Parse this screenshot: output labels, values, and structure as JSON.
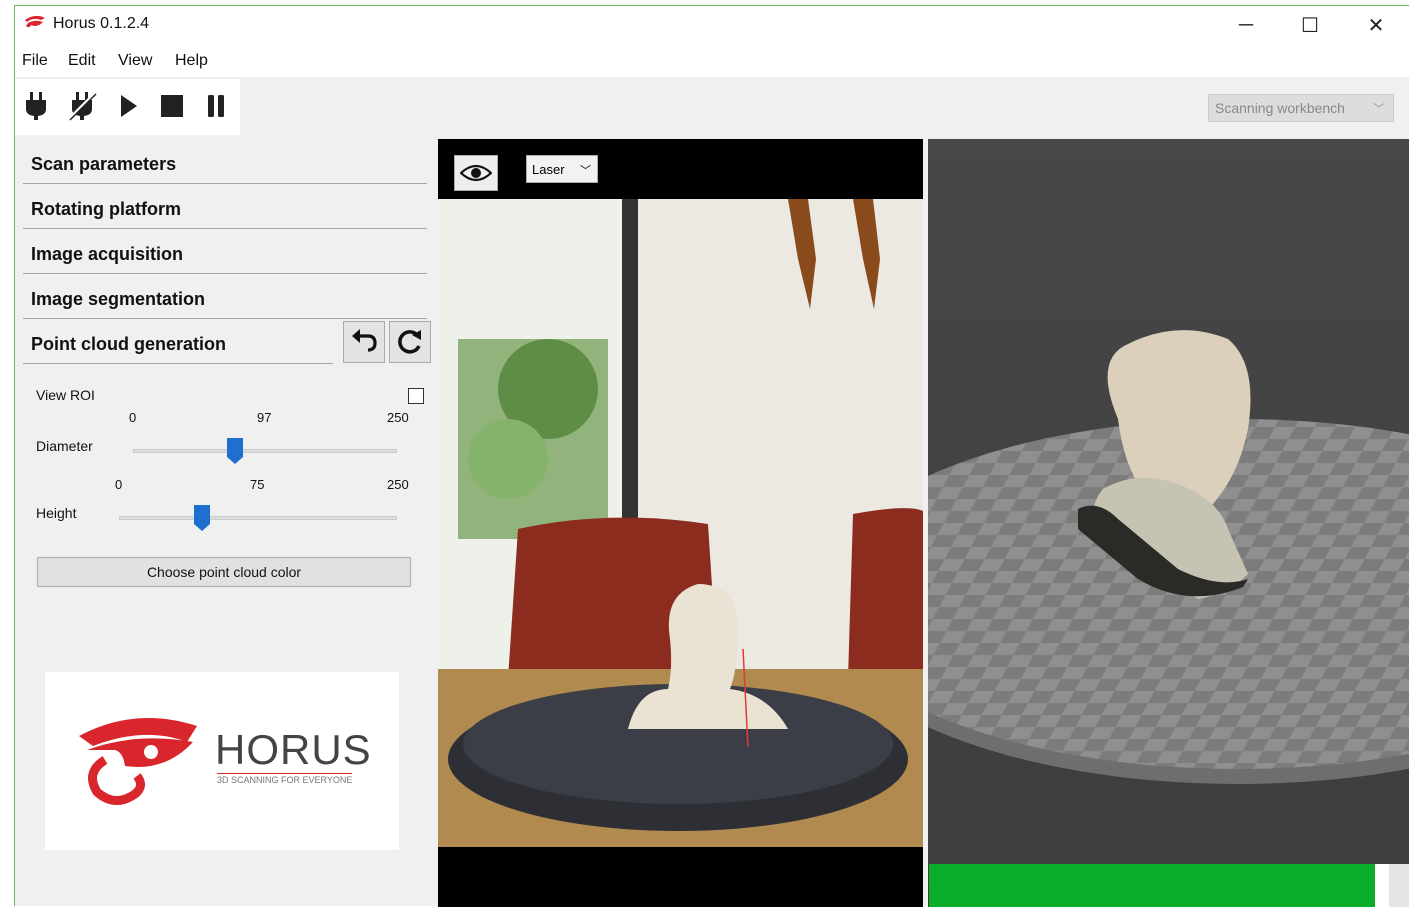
{
  "window": {
    "title": "Horus 0.1.2.4",
    "controls": {
      "minimize": "─",
      "maximize": "☐",
      "close": "✕"
    }
  },
  "menu": [
    "File",
    "Edit",
    "View",
    "Help"
  ],
  "toolbar": {
    "icons": [
      "connect-icon",
      "disconnect-icon",
      "play-icon",
      "stop-icon",
      "pause-icon"
    ]
  },
  "workbench": {
    "selected": "Scanning workbench"
  },
  "sections": [
    {
      "label": "Scan parameters"
    },
    {
      "label": "Rotating platform"
    },
    {
      "label": "Image acquisition"
    },
    {
      "label": "Image segmentation"
    },
    {
      "label": "Point cloud generation"
    }
  ],
  "roi": {
    "view_roi_label": "View ROI",
    "view_roi_checked": false,
    "diameter": {
      "label": "Diameter",
      "min": "0",
      "value": "97",
      "max": "250",
      "fraction": 0.388
    },
    "height": {
      "label": "Height",
      "min": "0",
      "value": "75",
      "max": "250",
      "fraction": 0.3
    }
  },
  "color_button": "Choose point cloud color",
  "logo": {
    "name": "HORUS",
    "tagline": "3D SCANNING FOR EVERYONE"
  },
  "video": {
    "mode": "Laser"
  },
  "scan_progress": 0.97,
  "colors": {
    "accent_green": "#09ae28",
    "logo_red": "#d8262c",
    "slider_blue": "#1f6fd1"
  }
}
